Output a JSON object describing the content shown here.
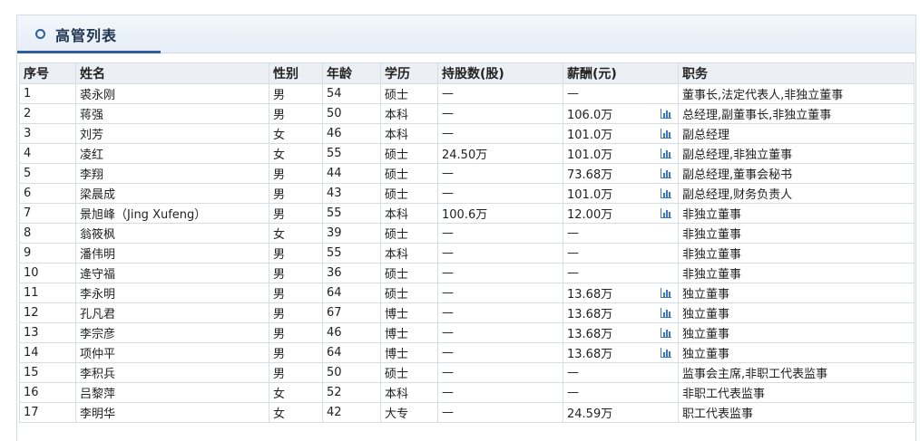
{
  "panel": {
    "title": "高管列表"
  },
  "table": {
    "headers": [
      "序号",
      "姓名",
      "性别",
      "年龄",
      "学历",
      "持股数(股)",
      "薪酬(元)",
      "职务"
    ],
    "rows": [
      {
        "no": "1",
        "name": "裘永刚",
        "gender": "男",
        "age": "54",
        "edu": "硕士",
        "shares": "—",
        "pay": "—",
        "chart": false,
        "role": "董事长,法定代表人,非独立董事"
      },
      {
        "no": "2",
        "name": "蒋强",
        "gender": "男",
        "age": "50",
        "edu": "本科",
        "shares": "—",
        "pay": "106.0万",
        "chart": true,
        "role": "总经理,副董事长,非独立董事"
      },
      {
        "no": "3",
        "name": "刘芳",
        "gender": "女",
        "age": "46",
        "edu": "本科",
        "shares": "—",
        "pay": "101.0万",
        "chart": true,
        "role": "副总经理"
      },
      {
        "no": "4",
        "name": "凌红",
        "gender": "女",
        "age": "55",
        "edu": "硕士",
        "shares": "24.50万",
        "pay": "101.0万",
        "chart": true,
        "role": "副总经理,非独立董事"
      },
      {
        "no": "5",
        "name": "李翔",
        "gender": "男",
        "age": "44",
        "edu": "硕士",
        "shares": "—",
        "pay": "73.68万",
        "chart": true,
        "role": "副总经理,董事会秘书"
      },
      {
        "no": "6",
        "name": "梁晨成",
        "gender": "男",
        "age": "43",
        "edu": "硕士",
        "shares": "—",
        "pay": "101.0万",
        "chart": true,
        "role": "副总经理,财务负责人"
      },
      {
        "no": "7",
        "name": "景旭峰（Jing Xufeng）",
        "gender": "男",
        "age": "55",
        "edu": "本科",
        "shares": "100.6万",
        "pay": "12.00万",
        "chart": true,
        "role": "非独立董事"
      },
      {
        "no": "8",
        "name": "翁筱枫",
        "gender": "女",
        "age": "39",
        "edu": "硕士",
        "shares": "—",
        "pay": "—",
        "chart": false,
        "role": "非独立董事"
      },
      {
        "no": "9",
        "name": "潘伟明",
        "gender": "男",
        "age": "55",
        "edu": "本科",
        "shares": "—",
        "pay": "—",
        "chart": false,
        "role": "非独立董事"
      },
      {
        "no": "10",
        "name": "逄守福",
        "gender": "男",
        "age": "36",
        "edu": "硕士",
        "shares": "—",
        "pay": "—",
        "chart": false,
        "role": "非独立董事"
      },
      {
        "no": "11",
        "name": "李永明",
        "gender": "男",
        "age": "64",
        "edu": "硕士",
        "shares": "—",
        "pay": "13.68万",
        "chart": true,
        "role": "独立董事"
      },
      {
        "no": "12",
        "name": "孔凡君",
        "gender": "男",
        "age": "67",
        "edu": "博士",
        "shares": "—",
        "pay": "13.68万",
        "chart": true,
        "role": "独立董事"
      },
      {
        "no": "13",
        "name": "李宗彦",
        "gender": "男",
        "age": "46",
        "edu": "博士",
        "shares": "—",
        "pay": "13.68万",
        "chart": true,
        "role": "独立董事"
      },
      {
        "no": "14",
        "name": "项仲平",
        "gender": "男",
        "age": "64",
        "edu": "博士",
        "shares": "—",
        "pay": "13.68万",
        "chart": true,
        "role": "独立董事"
      },
      {
        "no": "15",
        "name": "李积兵",
        "gender": "男",
        "age": "50",
        "edu": "硕士",
        "shares": "—",
        "pay": "—",
        "chart": false,
        "role": "监事会主席,非职工代表监事"
      },
      {
        "no": "16",
        "name": "吕黎萍",
        "gender": "女",
        "age": "52",
        "edu": "本科",
        "shares": "—",
        "pay": "—",
        "chart": false,
        "role": "非职工代表监事"
      },
      {
        "no": "17",
        "name": "李明华",
        "gender": "女",
        "age": "42",
        "edu": "大专",
        "shares": "—",
        "pay": "24.59万",
        "chart": false,
        "role": "职工代表监事"
      }
    ]
  },
  "colors": {
    "accent": "#2b5f9e",
    "chart_icon": "#3b78c4",
    "header_bg": "#eceff3",
    "border": "#d7dde5"
  },
  "icons": {
    "panel_bullet": "circle-icon",
    "pay_chart": "bar-chart-icon"
  }
}
